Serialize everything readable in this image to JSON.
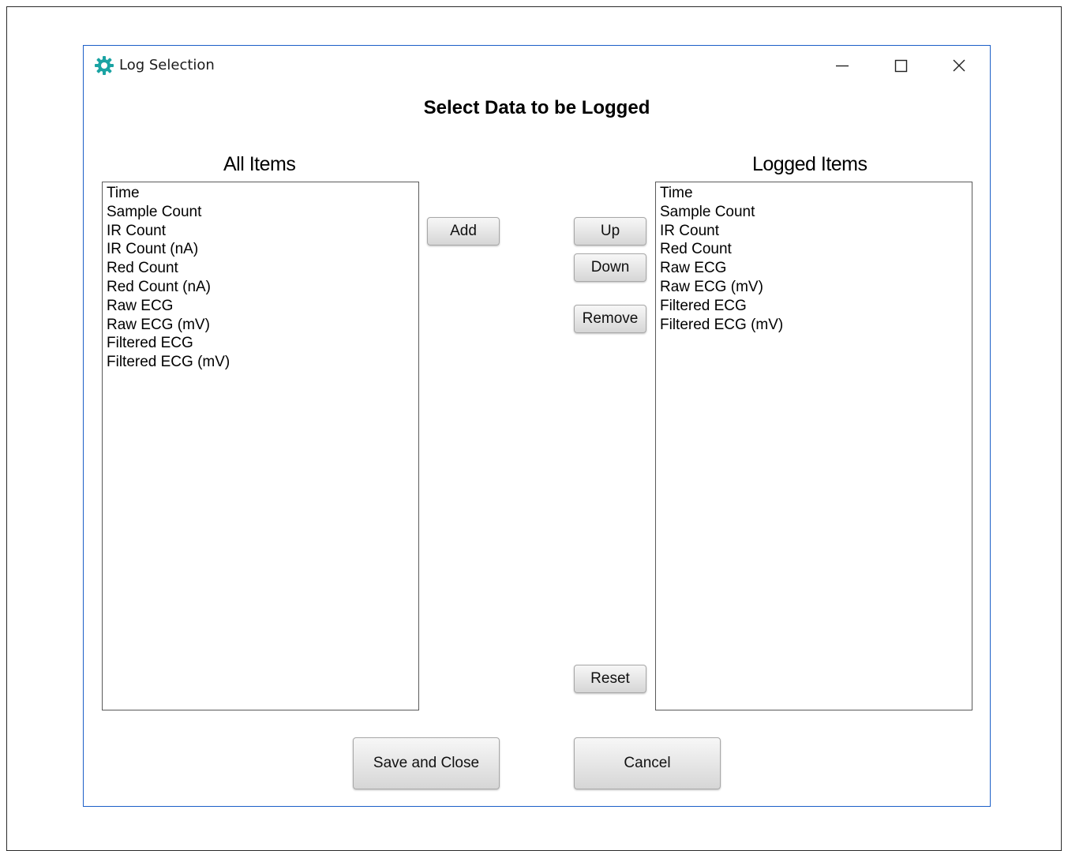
{
  "window": {
    "title": "Log Selection",
    "accent_color": "#1c5fc7",
    "icon_color": "#1aa3a3"
  },
  "heading": "Select Data to be Logged",
  "all_items": {
    "title": "All Items",
    "items": [
      "Time",
      "Sample Count",
      "IR Count",
      "IR Count (nA)",
      "Red Count",
      "Red Count (nA)",
      "Raw ECG",
      "Raw ECG (mV)",
      "Filtered ECG",
      "Filtered ECG (mV)"
    ]
  },
  "logged_items": {
    "title": "Logged Items",
    "items": [
      "Time",
      "Sample Count",
      "IR Count",
      "Red Count",
      "Raw ECG",
      "Raw ECG (mV)",
      "Filtered ECG",
      "Filtered ECG (mV)"
    ]
  },
  "buttons": {
    "add": "Add",
    "up": "Up",
    "down": "Down",
    "remove": "Remove",
    "reset": "Reset",
    "save_close": "Save and Close",
    "cancel": "Cancel"
  },
  "icons": {
    "app": "gear-icon",
    "minimize": "minimize-icon",
    "maximize": "maximize-icon",
    "close": "close-icon"
  }
}
